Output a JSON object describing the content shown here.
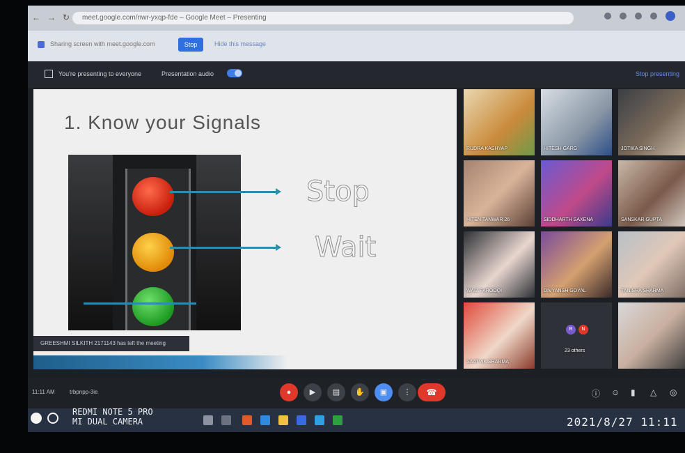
{
  "browser": {
    "url": "meet.google.com/nwr-yxqp-fde – Google Meet – Presenting",
    "infobar_text": "Sharing screen with meet.google.com",
    "infobar_button": "Stop",
    "infobar_link": "Hide this message"
  },
  "present_bar": {
    "text": "You're presenting to everyone",
    "audio_label": "Presentation audio",
    "stop_label": "Stop presenting"
  },
  "slide": {
    "title": "1. Know your Signals",
    "word_stop": "Stop",
    "word_wait": "Wait",
    "toast": "GREESHMI SILKITH 2171143 has left the meeting"
  },
  "participants": [
    {
      "name": "RUDRA KASHYAP"
    },
    {
      "name": "HITESH GARG"
    },
    {
      "name": "JOTIKA SINGH"
    },
    {
      "name": "HITEN TANWAR 26"
    },
    {
      "name": "SIDDHARTH SAXENA"
    },
    {
      "name": "SANSKAR GUPTA"
    },
    {
      "name": "WAIZ FAROOQI"
    },
    {
      "name": "DIVYANSH GOYAL"
    },
    {
      "name": "TANISHA SHARMA"
    },
    {
      "name": "SAATVIK SHARMA"
    },
    {
      "name": "23 others"
    },
    {
      "name": ""
    }
  ],
  "others_avatars": [
    "R",
    "N"
  ],
  "bottom_bar": {
    "time": "11:11 AM",
    "meeting_code": "trbpnpp-3ie"
  },
  "camera_watermark": {
    "line1": "REDMI NOTE 5 PRO",
    "line2": "MI DUAL CAMERA",
    "timestamp": "2021/8/27  11:11"
  },
  "colors": {
    "accent_blue": "#4e8ef0",
    "end_call_red": "#e0382b",
    "arrow_teal": "#2b8ea8"
  }
}
